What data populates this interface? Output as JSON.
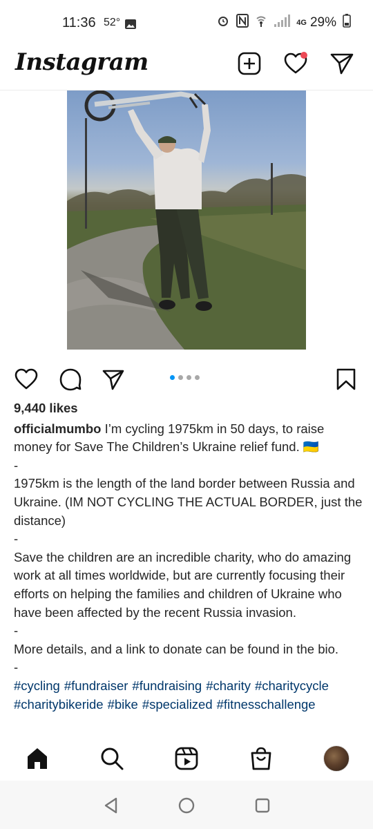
{
  "status_bar": {
    "time": "11:36",
    "temperature": "52°",
    "network": "4G",
    "battery": "29%"
  },
  "header": {
    "app_name": "Instagram",
    "icons": [
      "new-post-icon",
      "heart-icon",
      "direct-message-icon"
    ],
    "notification_dot_color": "#ed4956"
  },
  "post": {
    "carousel": {
      "count": 4,
      "active_index": 0,
      "active_color": "#0095f6"
    },
    "likes": "9,440 likes",
    "username": "officialmumbo",
    "caption_first": "I’m cycling 1975km in 50 days, to raise money for Save The Children’s Ukraine relief fund. 🇺🇦",
    "separator": "-",
    "paragraph_2": "1975km is the length of the land border between Russia and Ukraine. (IM NOT CYCLING THE ACTUAL BORDER, just the distance)",
    "paragraph_3": "Save the children are an incredible charity, who do amazing work at all times worldwide, but are currently focusing their efforts on helping the families and children of Ukraine who have been affected by the recent Russia invasion.",
    "paragraph_4": "More details, and a link to donate can be found in the bio.",
    "hashtags": [
      "#cycling",
      "#fundraiser",
      "#fundraising",
      "#charity",
      "#charitycycle",
      "#charitybikeride",
      "#bike",
      "#specialized",
      "#fitnesschallenge"
    ],
    "hashtag_color": "#00376b"
  },
  "bottom_nav": [
    "home-icon",
    "search-icon",
    "reels-icon",
    "shop-icon",
    "profile-avatar"
  ],
  "system_nav": [
    "back-icon",
    "home-circle-icon",
    "recents-icon"
  ]
}
